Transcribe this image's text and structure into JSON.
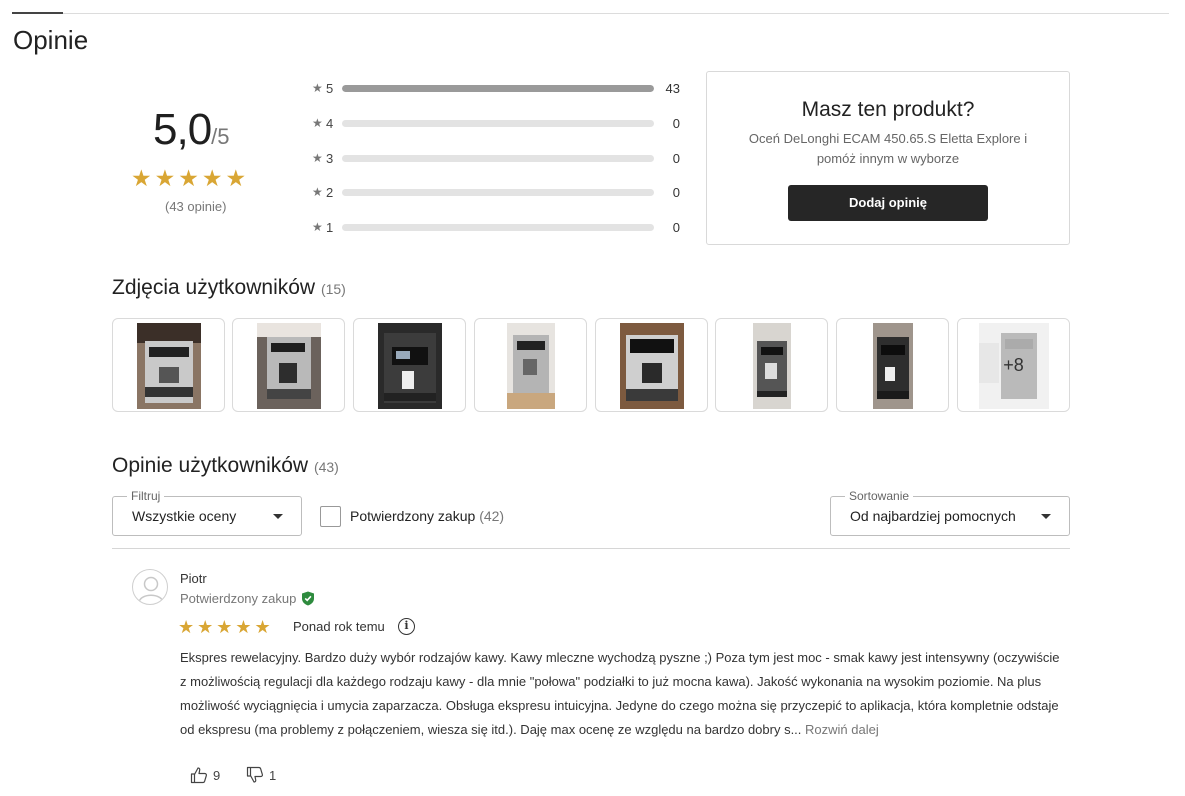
{
  "header": {
    "title": "Opinie"
  },
  "rating": {
    "average": "5,0",
    "out_of": "/5",
    "stars": 5,
    "count_label": "(43 opinie)",
    "distribution": [
      {
        "stars": "5",
        "count": "43",
        "fraction": 1.0
      },
      {
        "stars": "4",
        "count": "0",
        "fraction": 0
      },
      {
        "stars": "3",
        "count": "0",
        "fraction": 0
      },
      {
        "stars": "2",
        "count": "0",
        "fraction": 0
      },
      {
        "stars": "1",
        "count": "0",
        "fraction": 0
      }
    ]
  },
  "cta": {
    "title": "Masz ten produkt?",
    "text": "Oceń DeLonghi ECAM 450.65.S Eletta Explore i pomóż innym w wyborze",
    "button": "Dodaj opinię"
  },
  "photos": {
    "title": "Zdjęcia użytkowników",
    "count": "(15)",
    "more_label": "+8"
  },
  "reviews": {
    "title": "Opinie użytkowników",
    "count": "(43)",
    "filter": {
      "label": "Filtruj",
      "value": "Wszystkie oceny"
    },
    "verified_filter": {
      "label": "Potwierdzony zakup",
      "count": "(42)"
    },
    "sort": {
      "label": "Sortowanie",
      "value": "Od najbardziej pomocnych"
    },
    "items": [
      {
        "author": "Piotr",
        "verified": "Potwierdzony zakup",
        "stars": 5,
        "date": "Ponad rok temu",
        "text": "Ekspres rewelacyjny. Bardzo duży wybór rodzajów kawy. Kawy mleczne wychodzą pyszne ;) Poza tym jest moc - smak kawy jest intensywny (oczywiście z możliwością regulacji dla każdego rodzaju kawy - dla mnie \"połowa\" podziałki to już mocna kawa). Jakość wykonania na wysokim poziomie. Na plus możliwość wyciągnięcia i umycia zaparzacza. Obsługa ekspresu intuicyjna. Jedyne do czego można się przyczepić to aplikacja, która kompletnie odstaje od ekspresu (ma problemy z połączeniem, wiesza się itd.). Daję max ocenę ze względu na bardzo dobry s...",
        "expand": "Rozwiń dalej",
        "likes": "9",
        "dislikes": "1"
      }
    ]
  },
  "colors": {
    "star": "#d9a634",
    "bar_fill": "#9a9a9a",
    "bar_track": "#e3e3e3",
    "button": "#262626",
    "verified": "#2e8b3e"
  }
}
